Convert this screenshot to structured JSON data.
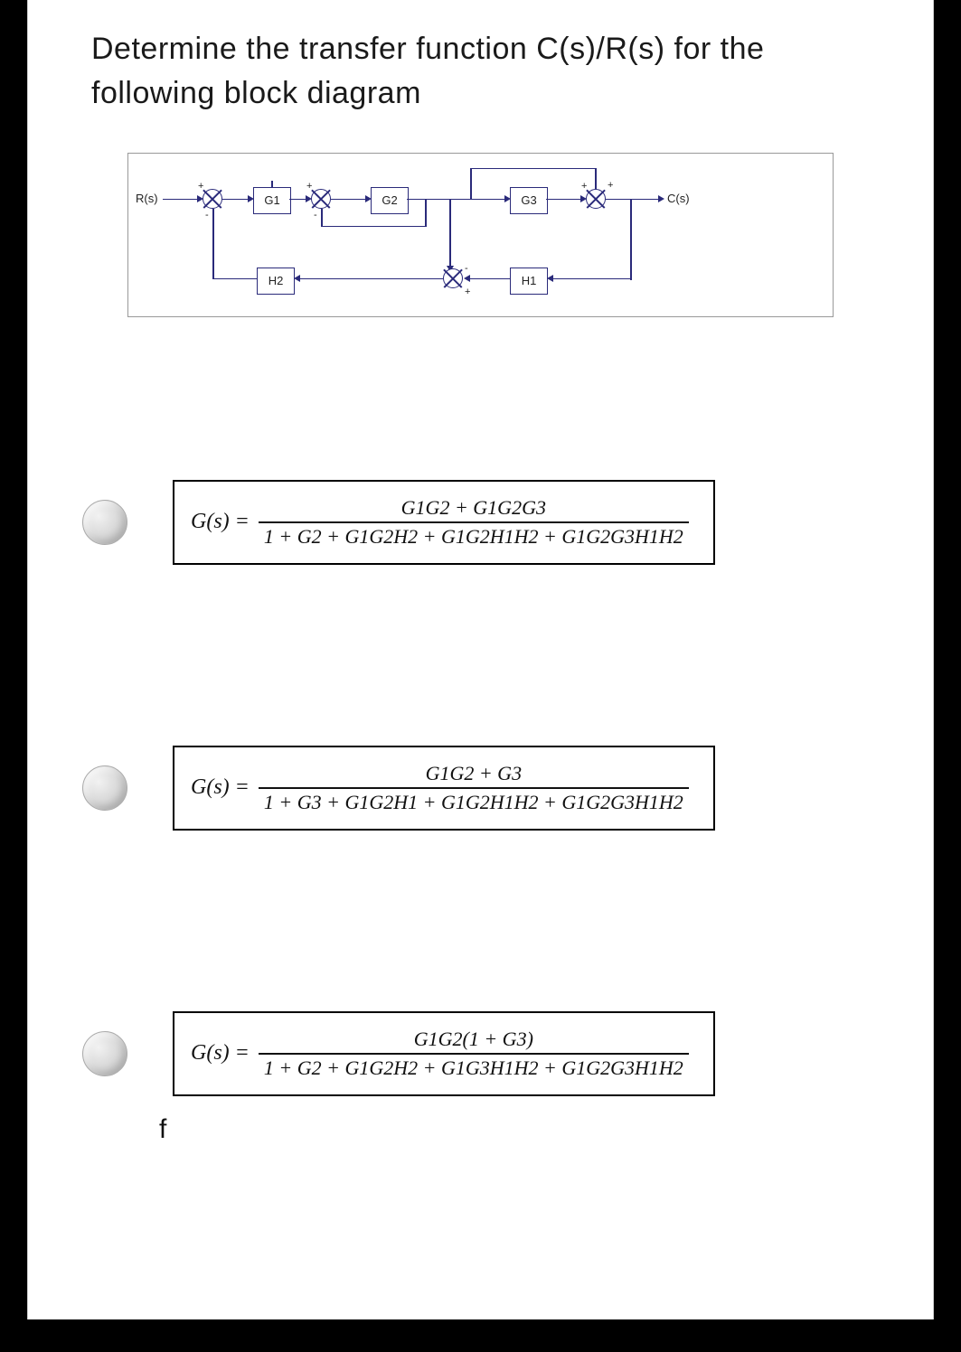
{
  "question": "Determine the transfer function C(s)/R(s) for the following block diagram",
  "diagram": {
    "input": "R(s)",
    "output": "C(s)",
    "blocks": {
      "g1": "G1",
      "g2": "G2",
      "g3": "G3",
      "h1": "H1",
      "h2": "H2"
    },
    "sum_signs": {
      "plus": "+",
      "minus": "-"
    }
  },
  "options": [
    {
      "lhs": "G(s) =",
      "numerator": "G1G2 + G1G2G3",
      "denominator": "1 + G2 + G1G2H2 + G1G2H1H2 + G1G2G3H1H2"
    },
    {
      "lhs": "G(s) =",
      "numerator": "G1G2 + G3",
      "denominator": "1 + G3 + G1G2H1 + G1G2H1H2 + G1G2G3H1H2"
    },
    {
      "lhs": "G(s) =",
      "numerator": "G1G2(1 + G3)",
      "denominator": "1 + G2 + G1G2H2 + G1G3H1H2 + G1G2G3H1H2"
    }
  ],
  "footer": "f"
}
